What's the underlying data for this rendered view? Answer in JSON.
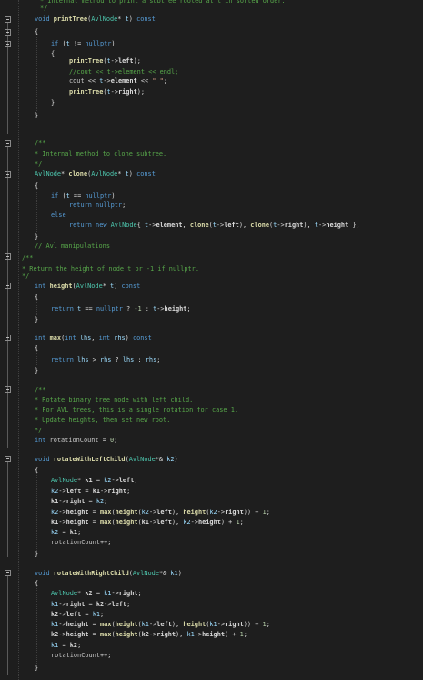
{
  "editor": {
    "language": "C++",
    "theme": {
      "background": "#1e1e1e",
      "keyword": "#569cd6",
      "type": "#4ec9b0",
      "function": "#dcdcaa",
      "comment": "#57a64a",
      "string": "#d69d85",
      "number": "#b5cea8",
      "parameter": "#9cdcfe",
      "text": "#dcdcdc"
    }
  },
  "code_lines": [
    [
      [
        "c",
        "* Internal method to print a subtree rooted at t in sorted order."
      ]
    ],
    [
      [
        "c",
        "*/"
      ]
    ],
    [
      [
        "k",
        "void "
      ],
      [
        "f",
        "printTree"
      ],
      [
        "o",
        "("
      ],
      [
        "t",
        "AvlNode"
      ],
      [
        "o",
        "* "
      ],
      [
        "p",
        "t"
      ],
      [
        "o",
        ") "
      ],
      [
        "k",
        "const"
      ]
    ],
    [
      [
        "o",
        "{"
      ]
    ],
    [
      [
        "k",
        "if "
      ],
      [
        "o",
        "("
      ],
      [
        "p",
        "t"
      ],
      [
        "o",
        " != "
      ],
      [
        "k",
        "nullptr"
      ],
      [
        "o",
        ")"
      ]
    ],
    [
      [
        "o",
        "{"
      ]
    ],
    [
      [
        "f",
        "printTree"
      ],
      [
        "o",
        "("
      ],
      [
        "p",
        "t"
      ],
      [
        "o",
        "->"
      ],
      [
        "m",
        "left"
      ],
      [
        "o",
        ");"
      ]
    ],
    [
      [
        "c",
        "//cout << t->element << endl;"
      ]
    ],
    [
      [
        "v",
        "cout"
      ],
      [
        "o",
        " << "
      ],
      [
        "p",
        "t"
      ],
      [
        "o",
        "->"
      ],
      [
        "m",
        "element"
      ],
      [
        "o",
        " << "
      ],
      [
        "s",
        "\" \""
      ],
      [
        "o",
        ";"
      ]
    ],
    [
      [
        "f",
        "printTree"
      ],
      [
        "o",
        "("
      ],
      [
        "p",
        "t"
      ],
      [
        "o",
        "->"
      ],
      [
        "m",
        "right"
      ],
      [
        "o",
        ");"
      ]
    ],
    [
      [
        "o",
        "}"
      ]
    ],
    [
      [
        "o",
        "}"
      ]
    ],
    [
      [
        "c",
        "/**"
      ]
    ],
    [
      [
        "c",
        "* Internal method to clone subtree."
      ]
    ],
    [
      [
        "c",
        "*/"
      ]
    ],
    [
      [
        "t",
        "AvlNode"
      ],
      [
        "o",
        "* "
      ],
      [
        "f",
        "clone"
      ],
      [
        "o",
        "("
      ],
      [
        "t",
        "AvlNode"
      ],
      [
        "o",
        "* "
      ],
      [
        "p",
        "t"
      ],
      [
        "o",
        ") "
      ],
      [
        "k",
        "const"
      ]
    ],
    [
      [
        "o",
        "{"
      ]
    ],
    [
      [
        "k",
        "if "
      ],
      [
        "o",
        "("
      ],
      [
        "p",
        "t"
      ],
      [
        "o",
        " == "
      ],
      [
        "k",
        "nullptr"
      ],
      [
        "o",
        ")"
      ]
    ],
    [
      [
        "k",
        "return "
      ],
      [
        "k",
        "nullptr"
      ],
      [
        "o",
        ";"
      ]
    ],
    [
      [
        "k",
        "else"
      ]
    ],
    [
      [
        "k",
        "return "
      ],
      [
        "k",
        "new "
      ],
      [
        "t",
        "AvlNode"
      ],
      [
        "o",
        "{ "
      ],
      [
        "p",
        "t"
      ],
      [
        "o",
        "->"
      ],
      [
        "m",
        "element"
      ],
      [
        "o",
        ", "
      ],
      [
        "f",
        "clone"
      ],
      [
        "o",
        "("
      ],
      [
        "p",
        "t"
      ],
      [
        "o",
        "->"
      ],
      [
        "m",
        "left"
      ],
      [
        "o",
        "), "
      ],
      [
        "f",
        "clone"
      ],
      [
        "o",
        "("
      ],
      [
        "p",
        "t"
      ],
      [
        "o",
        "->"
      ],
      [
        "m",
        "right"
      ],
      [
        "o",
        "), "
      ],
      [
        "p",
        "t"
      ],
      [
        "o",
        "->"
      ],
      [
        "m",
        "height"
      ],
      [
        "o",
        " };"
      ]
    ],
    [
      [
        "o",
        "}"
      ]
    ],
    [
      [
        "c",
        "// Avl manipulations"
      ]
    ],
    [
      [
        "c",
        "/**"
      ]
    ],
    [
      [
        "c",
        "* Return the height of node t or -1 if nullptr."
      ]
    ],
    [
      [
        "c",
        "*/"
      ]
    ],
    [
      [
        "k",
        "int "
      ],
      [
        "f",
        "height"
      ],
      [
        "o",
        "("
      ],
      [
        "t",
        "AvlNode"
      ],
      [
        "o",
        "* "
      ],
      [
        "p",
        "t"
      ],
      [
        "o",
        ") "
      ],
      [
        "k",
        "const"
      ]
    ],
    [
      [
        "o",
        "{"
      ]
    ],
    [
      [
        "k",
        "return "
      ],
      [
        "p",
        "t"
      ],
      [
        "o",
        " == "
      ],
      [
        "k",
        "nullptr"
      ],
      [
        "o",
        " ? "
      ],
      [
        "n",
        "-1"
      ],
      [
        "o",
        " : "
      ],
      [
        "p",
        "t"
      ],
      [
        "o",
        "->"
      ],
      [
        "m",
        "height"
      ],
      [
        "o",
        ";"
      ]
    ],
    [
      [
        "o",
        "}"
      ]
    ],
    [
      [
        "k",
        "int "
      ],
      [
        "f",
        "max"
      ],
      [
        "o",
        "("
      ],
      [
        "k",
        "int "
      ],
      [
        "p",
        "lhs"
      ],
      [
        "o",
        ", "
      ],
      [
        "k",
        "int "
      ],
      [
        "p",
        "rhs"
      ],
      [
        "o",
        ") "
      ],
      [
        "k",
        "const"
      ]
    ],
    [
      [
        "o",
        "{"
      ]
    ],
    [
      [
        "k",
        "return "
      ],
      [
        "p",
        "lhs"
      ],
      [
        "o",
        " > "
      ],
      [
        "p",
        "rhs"
      ],
      [
        "o",
        " ? "
      ],
      [
        "p",
        "lhs"
      ],
      [
        "o",
        " : "
      ],
      [
        "p",
        "rhs"
      ],
      [
        "o",
        ";"
      ]
    ],
    [
      [
        "o",
        "}"
      ]
    ],
    [
      [
        "c",
        "/**"
      ]
    ],
    [
      [
        "c",
        "* Rotate binary tree node with left child."
      ]
    ],
    [
      [
        "c",
        "* For AVL trees, this is a single rotation for case 1."
      ]
    ],
    [
      [
        "c",
        "* Update heights, then set new root."
      ]
    ],
    [
      [
        "c",
        "*/"
      ]
    ],
    [
      [
        "k",
        "int "
      ],
      [
        "v",
        "rotationCount"
      ],
      [
        "o",
        " = "
      ],
      [
        "n",
        "0"
      ],
      [
        "o",
        ";"
      ]
    ],
    [
      [
        "k",
        "void "
      ],
      [
        "f",
        "rotateWithLeftChild"
      ],
      [
        "o",
        "("
      ],
      [
        "t",
        "AvlNode"
      ],
      [
        "o",
        "*& "
      ],
      [
        "p",
        "k2"
      ],
      [
        "o",
        ")"
      ]
    ],
    [
      [
        "o",
        "{"
      ]
    ],
    [
      [
        "t",
        "AvlNode"
      ],
      [
        "o",
        "* "
      ],
      [
        "m",
        "k1"
      ],
      [
        "o",
        " = "
      ],
      [
        "p",
        "k2"
      ],
      [
        "o",
        "->"
      ],
      [
        "m",
        "left"
      ],
      [
        "o",
        ";"
      ]
    ],
    [
      [
        "p",
        "k2"
      ],
      [
        "o",
        "->"
      ],
      [
        "m",
        "left"
      ],
      [
        "o",
        " = "
      ],
      [
        "m",
        "k1"
      ],
      [
        "o",
        "->"
      ],
      [
        "m",
        "right"
      ],
      [
        "o",
        ";"
      ]
    ],
    [
      [
        "m",
        "k1"
      ],
      [
        "o",
        "->"
      ],
      [
        "m",
        "right"
      ],
      [
        "o",
        " = "
      ],
      [
        "p",
        "k2"
      ],
      [
        "o",
        ";"
      ]
    ],
    [
      [
        "p",
        "k2"
      ],
      [
        "o",
        "->"
      ],
      [
        "m",
        "height"
      ],
      [
        "o",
        " = "
      ],
      [
        "f",
        "max"
      ],
      [
        "o",
        "("
      ],
      [
        "f",
        "height"
      ],
      [
        "o",
        "("
      ],
      [
        "p",
        "k2"
      ],
      [
        "o",
        "->"
      ],
      [
        "m",
        "left"
      ],
      [
        "o",
        "), "
      ],
      [
        "f",
        "height"
      ],
      [
        "o",
        "("
      ],
      [
        "p",
        "k2"
      ],
      [
        "o",
        "->"
      ],
      [
        "m",
        "right"
      ],
      [
        "o",
        ")) + "
      ],
      [
        "n",
        "1"
      ],
      [
        "o",
        ";"
      ]
    ],
    [
      [
        "m",
        "k1"
      ],
      [
        "o",
        "->"
      ],
      [
        "m",
        "height"
      ],
      [
        "o",
        " = "
      ],
      [
        "f",
        "max"
      ],
      [
        "o",
        "("
      ],
      [
        "f",
        "height"
      ],
      [
        "o",
        "("
      ],
      [
        "m",
        "k1"
      ],
      [
        "o",
        "->"
      ],
      [
        "m",
        "left"
      ],
      [
        "o",
        "), "
      ],
      [
        "p",
        "k2"
      ],
      [
        "o",
        "->"
      ],
      [
        "m",
        "height"
      ],
      [
        "o",
        ") + "
      ],
      [
        "n",
        "1"
      ],
      [
        "o",
        ";"
      ]
    ],
    [
      [
        "p",
        "k2"
      ],
      [
        "o",
        " = "
      ],
      [
        "m",
        "k1"
      ],
      [
        "o",
        ";"
      ]
    ],
    [
      [
        "v",
        "rotationCount"
      ],
      [
        "o",
        "++;"
      ]
    ],
    [
      [
        "o",
        "}"
      ]
    ],
    [
      [
        "k",
        "void "
      ],
      [
        "f",
        "rotateWithRightChild"
      ],
      [
        "o",
        "("
      ],
      [
        "t",
        "AvlNode"
      ],
      [
        "o",
        "*& "
      ],
      [
        "p",
        "k1"
      ],
      [
        "o",
        ")"
      ]
    ],
    [
      [
        "o",
        "{"
      ]
    ],
    [
      [
        "t",
        "AvlNode"
      ],
      [
        "o",
        "* "
      ],
      [
        "m",
        "k2"
      ],
      [
        "o",
        " = "
      ],
      [
        "p",
        "k1"
      ],
      [
        "o",
        "->"
      ],
      [
        "m",
        "right"
      ],
      [
        "o",
        ";"
      ]
    ],
    [
      [
        "p",
        "k1"
      ],
      [
        "o",
        "->"
      ],
      [
        "m",
        "right"
      ],
      [
        "o",
        " = "
      ],
      [
        "m",
        "k2"
      ],
      [
        "o",
        "->"
      ],
      [
        "m",
        "left"
      ],
      [
        "o",
        ";"
      ]
    ],
    [
      [
        "m",
        "k2"
      ],
      [
        "o",
        "->"
      ],
      [
        "m",
        "left"
      ],
      [
        "o",
        " = "
      ],
      [
        "p",
        "k1"
      ],
      [
        "o",
        ";"
      ]
    ],
    [
      [
        "p",
        "k1"
      ],
      [
        "o",
        "->"
      ],
      [
        "m",
        "height"
      ],
      [
        "o",
        " = "
      ],
      [
        "f",
        "max"
      ],
      [
        "o",
        "("
      ],
      [
        "f",
        "height"
      ],
      [
        "o",
        "("
      ],
      [
        "p",
        "k1"
      ],
      [
        "o",
        "->"
      ],
      [
        "m",
        "left"
      ],
      [
        "o",
        "), "
      ],
      [
        "f",
        "height"
      ],
      [
        "o",
        "("
      ],
      [
        "p",
        "k1"
      ],
      [
        "o",
        "->"
      ],
      [
        "m",
        "right"
      ],
      [
        "o",
        ")) + "
      ],
      [
        "n",
        "1"
      ],
      [
        "o",
        ";"
      ]
    ],
    [
      [
        "m",
        "k2"
      ],
      [
        "o",
        "->"
      ],
      [
        "m",
        "height"
      ],
      [
        "o",
        " = "
      ],
      [
        "f",
        "max"
      ],
      [
        "o",
        "("
      ],
      [
        "f",
        "height"
      ],
      [
        "o",
        "("
      ],
      [
        "m",
        "k2"
      ],
      [
        "o",
        "->"
      ],
      [
        "m",
        "right"
      ],
      [
        "o",
        "), "
      ],
      [
        "p",
        "k1"
      ],
      [
        "o",
        "->"
      ],
      [
        "m",
        "height"
      ],
      [
        "o",
        ") + "
      ],
      [
        "n",
        "1"
      ],
      [
        "o",
        ";"
      ]
    ],
    [
      [
        "p",
        "k1"
      ],
      [
        "o",
        " = "
      ],
      [
        "m",
        "k2"
      ],
      [
        "o",
        ";"
      ]
    ],
    [
      [
        "v",
        "rotationCount"
      ],
      [
        "o",
        "++;"
      ]
    ],
    [
      [
        "o",
        "}"
      ]
    ]
  ]
}
